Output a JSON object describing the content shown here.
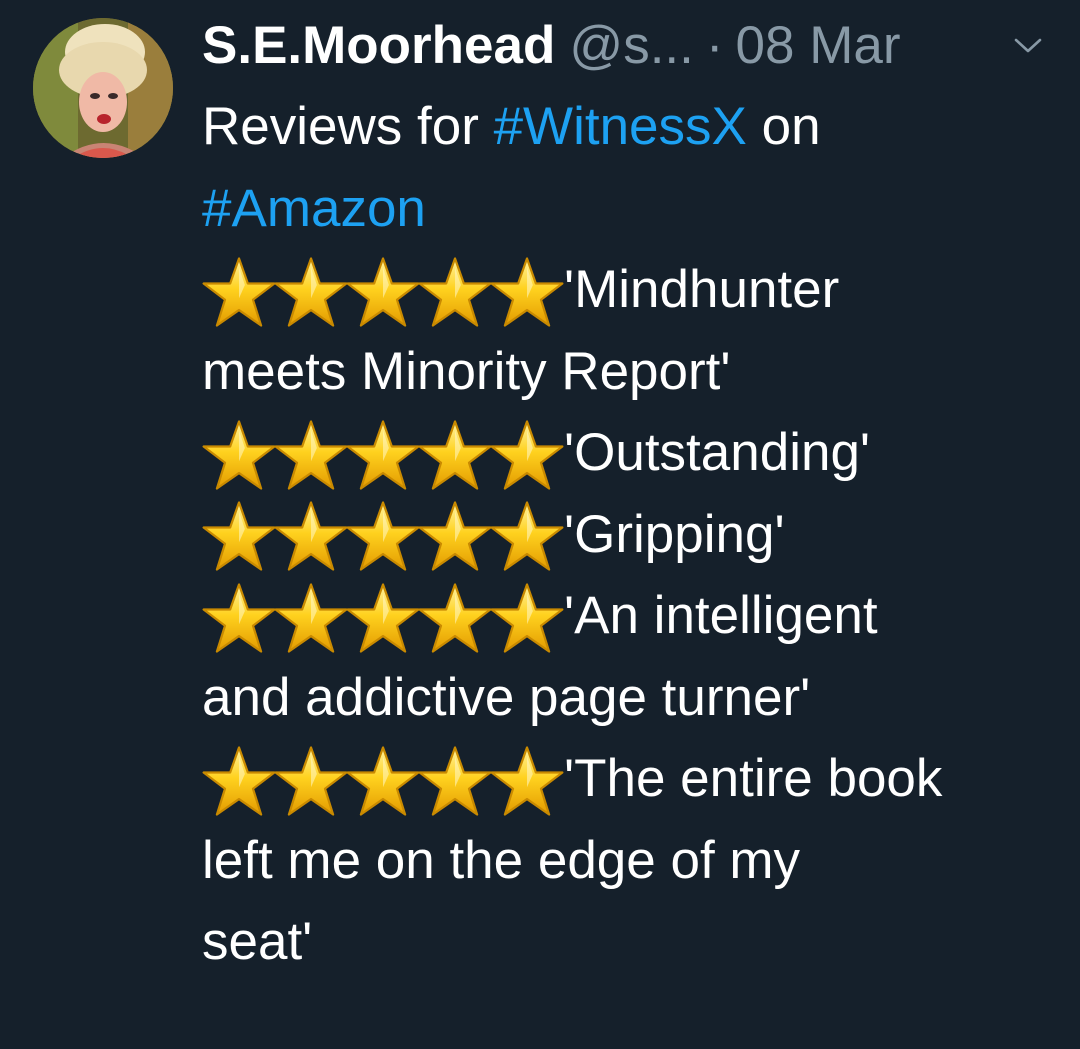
{
  "tweet": {
    "display_name": "S.E.Moorhead",
    "handle": "@s...",
    "separator": "·",
    "date": "08 Mar",
    "icons": {
      "avatar": "profile-photo",
      "caret": "chevron-down-icon",
      "star": "star-icon"
    },
    "lines": {
      "l1_text": "Reviews for ",
      "l1_hashtag": "#WitnessX",
      "l1_tail": " on",
      "l2_hashtag": "#Amazon",
      "review1_a": "'Mindhunter",
      "review1_b": "meets Minority Report'",
      "review2": "'Outstanding'",
      "review3": "'Gripping'",
      "review4_a": "'An intelligent",
      "review4_b": "and addictive page turner'",
      "review5_a": "'The entire book",
      "review5_b": "left me on the edge of my",
      "review5_c": "seat'"
    },
    "ratings": [
      5,
      5,
      5,
      5,
      5
    ],
    "colors": {
      "background": "#15202b",
      "text": "#ffffff",
      "secondary": "#8899a6",
      "hashtag": "#1da1f2",
      "star": "#f7c21b"
    }
  }
}
